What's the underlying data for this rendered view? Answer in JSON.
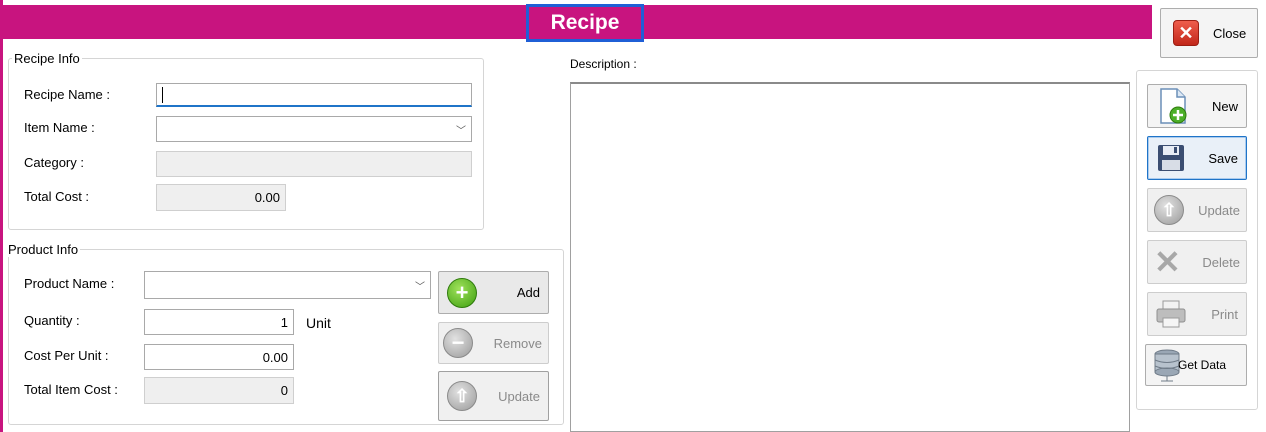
{
  "window": {
    "title": "Recipe",
    "close_label": "Close"
  },
  "recipe_info": {
    "group_title": "Recipe Info",
    "recipe_name_label": "Recipe Name :",
    "recipe_name_value": "",
    "item_name_label": "Item Name :",
    "item_name_value": "",
    "category_label": "Category :",
    "category_value": "",
    "total_cost_label": "Total Cost :",
    "total_cost_value": "0.00"
  },
  "product_info": {
    "group_title": "Product Info",
    "product_name_label": "Product Name :",
    "product_name_value": "",
    "quantity_label": "Quantity :",
    "quantity_value": "1",
    "unit_label": "Unit",
    "cost_per_unit_label": "Cost Per Unit :",
    "cost_per_unit_value": "0.00",
    "total_item_cost_label": "Total Item Cost :",
    "total_item_cost_value": "0",
    "add_label": "Add",
    "remove_label": "Remove",
    "update_label": "Update"
  },
  "description": {
    "label": "Description :",
    "value": ""
  },
  "actions": {
    "new_label": "New",
    "save_label": "Save",
    "update_label": "Update",
    "delete_label": "Delete",
    "print_label": "Print",
    "get_data_label": "Get Data"
  },
  "colors": {
    "title_bar": "#c8147f",
    "title_highlight": "#1f5fd6",
    "focus": "#1f74c8"
  },
  "icons": {
    "close": "close-x-icon",
    "add": "plus-circle-icon",
    "remove": "minus-circle-icon",
    "update": "up-arrow-circle-icon",
    "new": "new-document-icon",
    "save": "floppy-disk-icon",
    "delete": "x-icon",
    "print": "printer-icon",
    "get_data": "database-icon"
  }
}
